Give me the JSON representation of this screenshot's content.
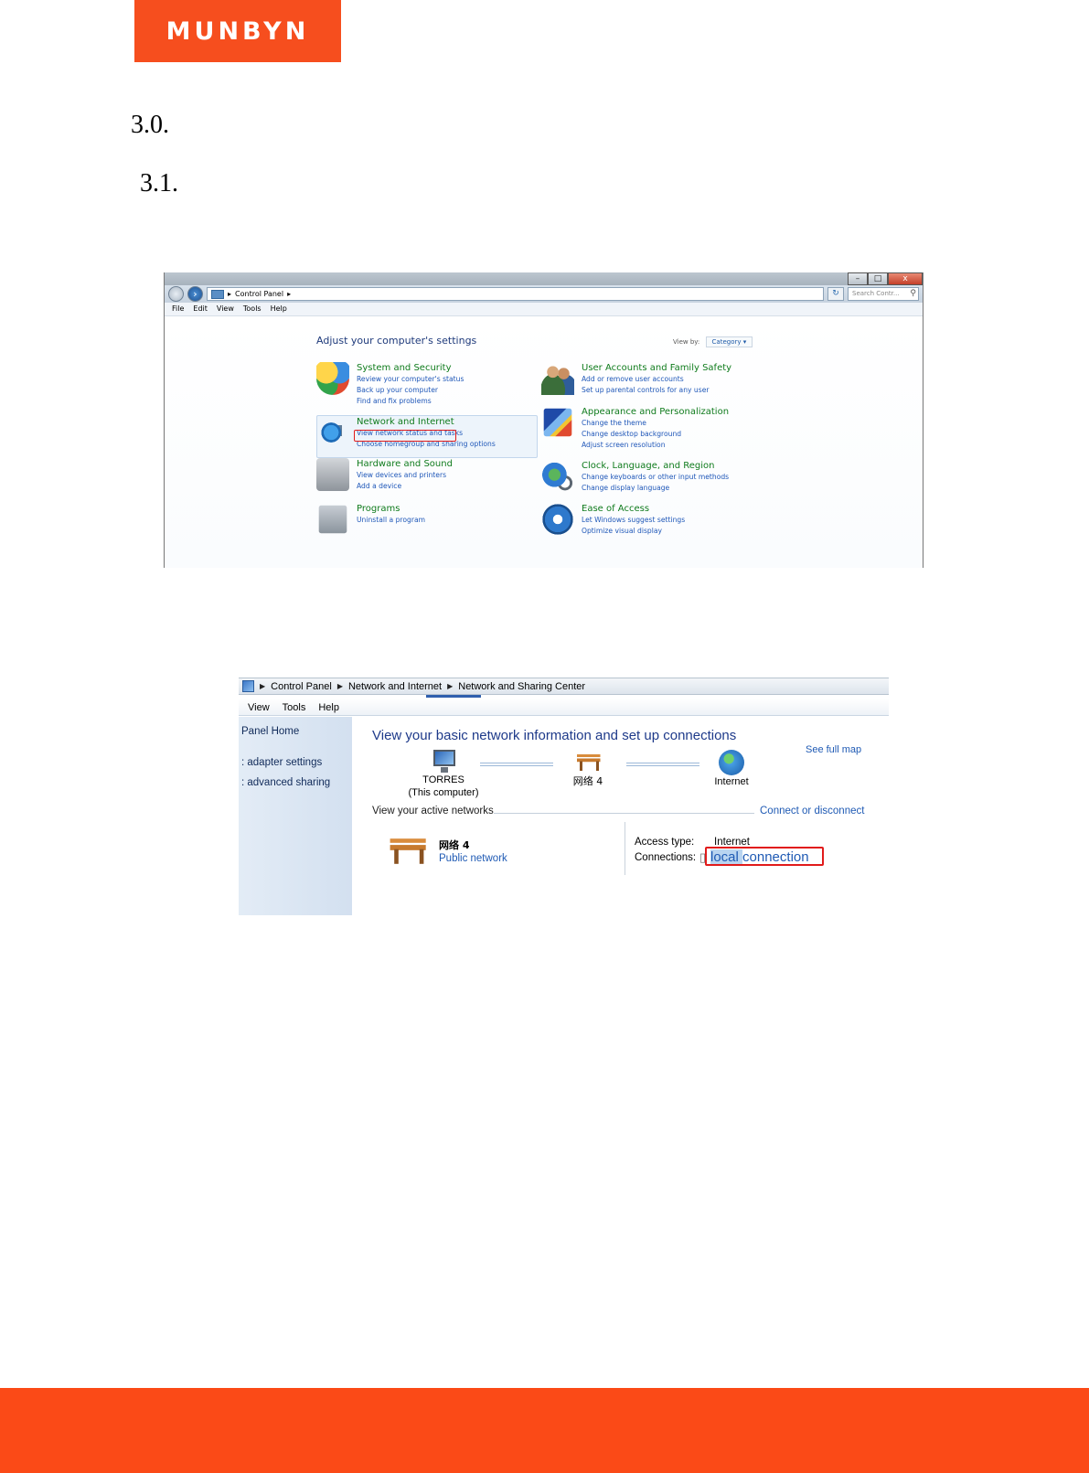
{
  "brand": {
    "logo_text": "MUNBYN",
    "accent": "#f64e1e",
    "footer_color": "#fb4a17"
  },
  "headings": {
    "h1": "3.0.",
    "h2": "3.1."
  },
  "control_panel": {
    "address": {
      "path": "Control Panel",
      "search_placeholder": "Search Contr..."
    },
    "window_buttons": {
      "minimize": "–",
      "maximize": "□",
      "close": "x"
    },
    "menu": [
      "File",
      "Edit",
      "View",
      "Tools",
      "Help"
    ],
    "heading": "Adjust your computer's settings",
    "view_by_label": "View by:",
    "view_by_value": "Category",
    "categories": [
      {
        "title": "System and Security",
        "icon": "shield-icon",
        "links": [
          "Review your computer's status",
          "Back up your computer",
          "Find and fix problems"
        ]
      },
      {
        "title": "Network and Internet",
        "icon": "network-globe-icon",
        "links": [
          "View network status and tasks",
          "Choose homegroup and sharing options"
        ]
      },
      {
        "title": "Hardware and Sound",
        "icon": "printer-icon",
        "links": [
          "View devices and printers",
          "Add a device"
        ]
      },
      {
        "title": "Programs",
        "icon": "programs-icon",
        "links": [
          "Uninstall a program"
        ]
      },
      {
        "title": "User Accounts and Family Safety",
        "icon": "users-icon",
        "links": [
          "Add or remove user accounts",
          "Set up parental controls for any user"
        ]
      },
      {
        "title": "Appearance and Personalization",
        "icon": "appearance-icon",
        "links": [
          "Change the theme",
          "Change desktop background",
          "Adjust screen resolution"
        ]
      },
      {
        "title": "Clock, Language, and Region",
        "icon": "clock-globe-icon",
        "links": [
          "Change keyboards or other input methods",
          "Change display language"
        ]
      },
      {
        "title": "Ease of Access",
        "icon": "ease-of-access-icon",
        "links": [
          "Let Windows suggest settings",
          "Optimize visual display"
        ]
      }
    ]
  },
  "network_center": {
    "breadcrumb": [
      "Control Panel",
      "Network and Internet",
      "Network and Sharing Center"
    ],
    "menu": [
      "View",
      "Tools",
      "Help"
    ],
    "sidebar": [
      "Panel Home",
      ": adapter settings",
      ": advanced sharing"
    ],
    "title": "View your basic network information and set up connections",
    "see_full_map": "See full map",
    "nodes": {
      "computer_name": "TORRES",
      "computer_sub": "(This computer)",
      "network": "网络 4",
      "internet": "Internet"
    },
    "active_networks_label": "View your active networks",
    "connect_or_disconnect": "Connect or disconnect",
    "network_name": "网络  4",
    "network_type": "Public network",
    "access_type_label": "Access type:",
    "access_type_value": "Internet",
    "connections_label": "Connections:",
    "connection_highlight": "local ",
    "connection_rest": "connection"
  }
}
